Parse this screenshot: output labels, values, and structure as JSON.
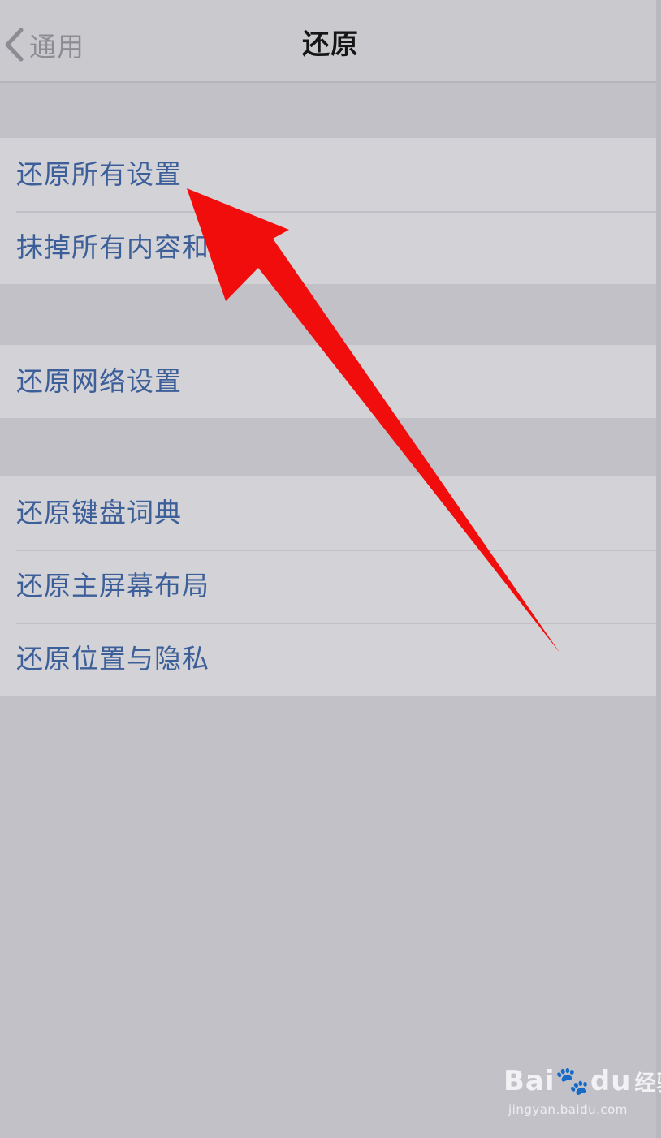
{
  "nav": {
    "back_label": "通用",
    "title": "还原"
  },
  "groups": [
    {
      "items": [
        {
          "label": "还原所有设置"
        },
        {
          "label": "抹掉所有内容和"
        }
      ]
    },
    {
      "items": [
        {
          "label": "还原网络设置"
        }
      ]
    },
    {
      "items": [
        {
          "label": "还原键盘词典"
        },
        {
          "label": "还原主屏幕布局"
        },
        {
          "label": "还原位置与隐私"
        }
      ]
    }
  ],
  "annotation": {
    "arrow_color": "#f20d0d",
    "icon": "red-arrow-icon"
  },
  "watermark": {
    "logo": "Bai",
    "logo_suffix": "du",
    "logo_cn": "经验",
    "url": "jingyan.baidu.com"
  },
  "colors": {
    "link_blue": "#3d5f99",
    "background": "#c2c1c7",
    "cell": "#d3d3d7"
  }
}
